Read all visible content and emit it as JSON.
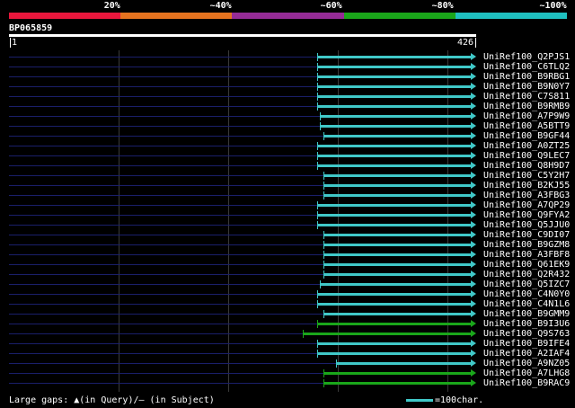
{
  "legend": {
    "segments": [
      {
        "color": "#e8173c",
        "label": "20%"
      },
      {
        "color": "#e6731f",
        "label": "~40%"
      },
      {
        "color": "#952b96",
        "label": "~60%"
      },
      {
        "color": "#1aa61a",
        "label": "~80%"
      },
      {
        "color": "#1fc0c0",
        "label": "~100%"
      }
    ]
  },
  "query": {
    "name": "BP065859",
    "start_label": "1",
    "end_label": "426",
    "length": 426
  },
  "hits": [
    {
      "label": "UniRef100_Q2PJS1",
      "start": 284,
      "color": "#40c8c8"
    },
    {
      "label": "UniRef100_C6TLQ2",
      "start": 284,
      "color": "#40c8c8"
    },
    {
      "label": "UniRef100_B9RBG1",
      "start": 284,
      "color": "#40c8c8"
    },
    {
      "label": "UniRef100_B9N0Y7",
      "start": 284,
      "color": "#40c8c8"
    },
    {
      "label": "UniRef100_C7S811",
      "start": 284,
      "color": "#40c8c8"
    },
    {
      "label": "UniRef100_B9RMB9",
      "start": 284,
      "color": "#40c8c8"
    },
    {
      "label": "UniRef100_A7P9W9",
      "start": 287,
      "color": "#40c8c8"
    },
    {
      "label": "UniRef100_A5BTT9",
      "start": 287,
      "color": "#40c8c8"
    },
    {
      "label": "UniRef100_B9GF44",
      "start": 290,
      "color": "#40c8c8"
    },
    {
      "label": "UniRef100_A0ZT25",
      "start": 284,
      "color": "#40c8c8"
    },
    {
      "label": "UniRef100_Q9LEC7",
      "start": 284,
      "color": "#40c8c8"
    },
    {
      "label": "UniRef100_Q8H9D7",
      "start": 284,
      "color": "#40c8c8"
    },
    {
      "label": "UniRef100_C5Y2H7",
      "start": 290,
      "color": "#40c8c8"
    },
    {
      "label": "UniRef100_B2KJ55",
      "start": 290,
      "color": "#40c8c8"
    },
    {
      "label": "UniRef100_A3FBG3",
      "start": 290,
      "color": "#40c8c8"
    },
    {
      "label": "UniRef100_A7QP29",
      "start": 284,
      "color": "#40c8c8"
    },
    {
      "label": "UniRef100_Q9FYA2",
      "start": 284,
      "color": "#40c8c8"
    },
    {
      "label": "UniRef100_Q5JJU0",
      "start": 284,
      "color": "#40c8c8"
    },
    {
      "label": "UniRef100_C9DI07",
      "start": 290,
      "color": "#40c8c8"
    },
    {
      "label": "UniRef100_B9GZM8",
      "start": 290,
      "color": "#40c8c8"
    },
    {
      "label": "UniRef100_A3FBF8",
      "start": 290,
      "color": "#40c8c8"
    },
    {
      "label": "UniRef100_Q61EK9",
      "start": 290,
      "color": "#40c8c8"
    },
    {
      "label": "UniRef100_Q2R432",
      "start": 290,
      "color": "#40c8c8"
    },
    {
      "label": "UniRef100_Q5IZC7",
      "start": 287,
      "color": "#40c8c8"
    },
    {
      "label": "UniRef100_C4N0Y0",
      "start": 284,
      "color": "#40c8c8"
    },
    {
      "label": "UniRef100_C4N1L6",
      "start": 284,
      "color": "#40c8c8"
    },
    {
      "label": "UniRef100_B9GMM9",
      "start": 290,
      "color": "#40c8c8"
    },
    {
      "label": "UniRef100_B9I3U6",
      "start": 284,
      "color": "#1aa61a"
    },
    {
      "label": "UniRef100_Q9S763",
      "start": 271,
      "color": "#1aa61a"
    },
    {
      "label": "UniRef100_B9IFE4",
      "start": 284,
      "color": "#40c8c8"
    },
    {
      "label": "UniRef100_A2IAF4",
      "start": 284,
      "color": "#40c8c8"
    },
    {
      "label": "UniRef100_A9NZ05",
      "start": 302,
      "color": "#40c8c8"
    },
    {
      "label": "UniRef100_A7LHG8",
      "start": 290,
      "color": "#1aa61a"
    },
    {
      "label": "UniRef100_B9RAC9",
      "start": 290,
      "color": "#1aa61a"
    }
  ],
  "footer": {
    "gaps_text": "Large gaps: ▲(in Query)/— (in Subject)",
    "scale_text": "=100char."
  }
}
